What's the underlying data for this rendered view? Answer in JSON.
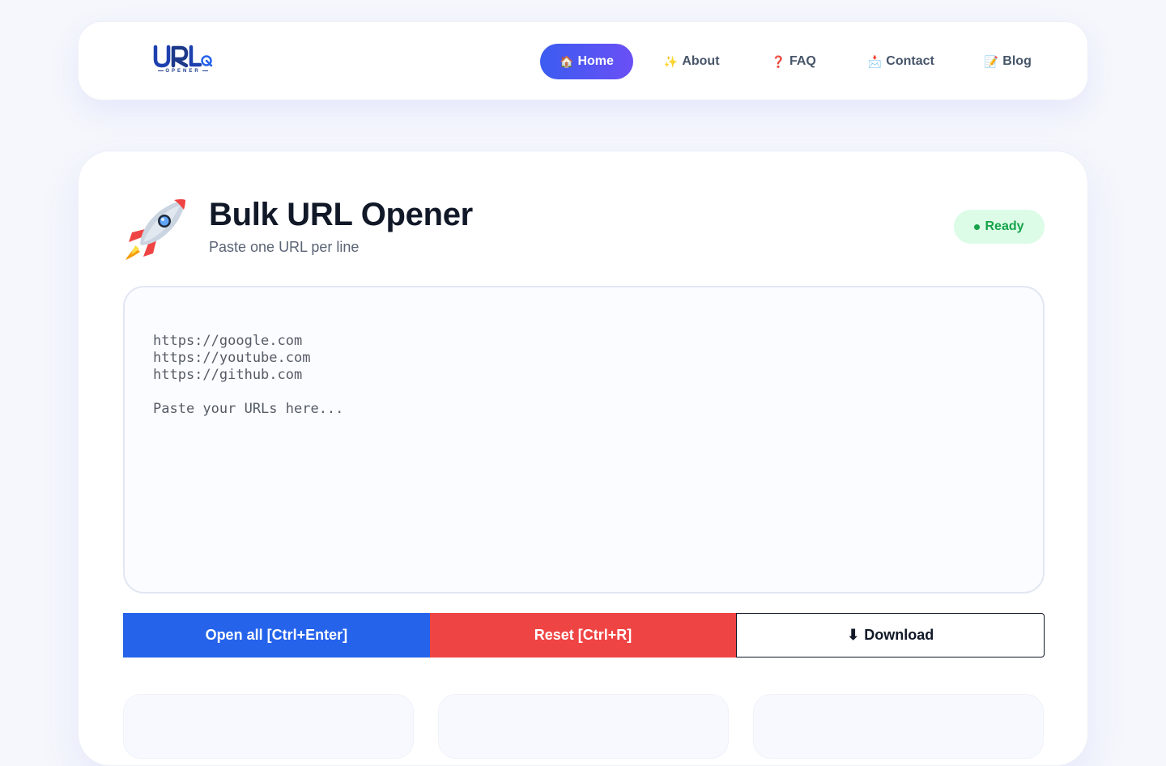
{
  "nav": {
    "logo": {
      "mark": "URL",
      "subtext": "OPENER"
    },
    "links": [
      {
        "label": "Home",
        "icon": "🏠",
        "active": true
      },
      {
        "label": "About",
        "icon": "✨",
        "active": false
      },
      {
        "label": "FAQ",
        "icon": "❓",
        "active": false
      },
      {
        "label": "Contact",
        "icon": "📩",
        "active": false
      },
      {
        "label": "Blog",
        "icon": "📝",
        "active": false
      }
    ]
  },
  "main": {
    "icon": "rocket-icon",
    "title": "Bulk URL Opener",
    "subtitle": "Paste one URL per line",
    "status": "Ready",
    "input": {
      "value": "",
      "placeholder": "https://google.com\nhttps://youtube.com\nhttps://github.com\n\nPaste your URLs here..."
    },
    "buttons": {
      "open_label": "Open all [Ctrl+Enter]",
      "reset_label": "Reset [Ctrl+R]",
      "download_label": "Download",
      "download_icon": "⬇"
    }
  },
  "colors": {
    "primary": "#2563eb",
    "danger": "#ef4444",
    "success": "#16a34a",
    "success_bg": "#dcfce7",
    "nav_active_start": "#3b5cf0",
    "nav_active_end": "#6a4ff5"
  }
}
